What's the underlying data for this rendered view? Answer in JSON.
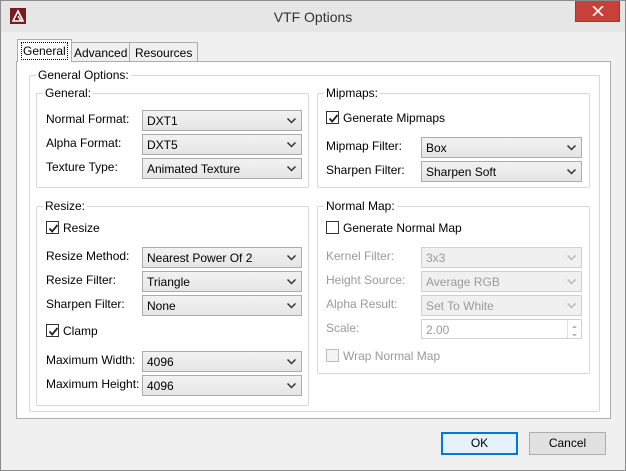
{
  "window": {
    "title": "VTF Options"
  },
  "tabs": [
    {
      "label": "General"
    },
    {
      "label": "Advanced"
    },
    {
      "label": "Resources"
    }
  ],
  "general_options": {
    "title": "General Options:",
    "general": {
      "title": "General:",
      "normal_format": {
        "label": "Normal Format:",
        "value": "DXT1"
      },
      "alpha_format": {
        "label": "Alpha Format:",
        "value": "DXT5"
      },
      "texture_type": {
        "label": "Texture Type:",
        "value": "Animated Texture"
      }
    },
    "mipmaps": {
      "title": "Mipmaps:",
      "generate": {
        "label": "Generate Mipmaps",
        "checked": true
      },
      "mipmap_filter": {
        "label": "Mipmap Filter:",
        "value": "Box"
      },
      "sharpen_filter": {
        "label": "Sharpen Filter:",
        "value": "Sharpen Soft"
      }
    },
    "resize": {
      "title": "Resize:",
      "resize_check": {
        "label": "Resize",
        "checked": true
      },
      "resize_method": {
        "label": "Resize Method:",
        "value": "Nearest Power Of 2"
      },
      "resize_filter": {
        "label": "Resize Filter:",
        "value": "Triangle"
      },
      "sharpen_filter": {
        "label": "Sharpen Filter:",
        "value": "None"
      },
      "clamp": {
        "label": "Clamp",
        "checked": true
      },
      "max_width": {
        "label": "Maximum Width:",
        "value": "4096"
      },
      "max_height": {
        "label": "Maximum Height:",
        "value": "4096"
      }
    },
    "normal_map": {
      "title": "Normal Map:",
      "generate": {
        "label": "Generate Normal Map",
        "checked": false
      },
      "kernel_filter": {
        "label": "Kernel Filter:",
        "value": "3x3"
      },
      "height_source": {
        "label": "Height Source:",
        "value": "Average RGB"
      },
      "alpha_result": {
        "label": "Alpha Result:",
        "value": "Set To White"
      },
      "scale": {
        "label": "Scale:",
        "value": "2.00"
      },
      "wrap": {
        "label": "Wrap Normal Map",
        "checked": false
      }
    }
  },
  "buttons": {
    "ok": "OK",
    "cancel": "Cancel"
  },
  "colors": {
    "close_button": "#c7413a",
    "default_button_border": "#0078d7"
  }
}
